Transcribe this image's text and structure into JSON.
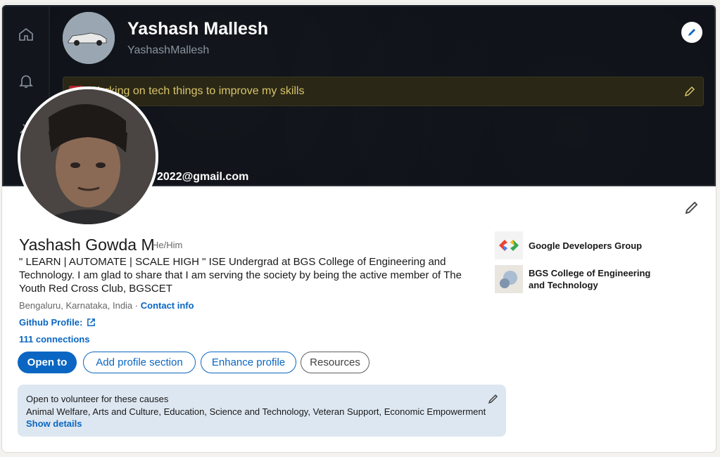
{
  "banner": {
    "github_name": "Yashash Mallesh",
    "github_username": "YashashMallesh",
    "status_text": "Working on tech things to improve my skills",
    "email_partial": "2022@gmail.com",
    "rail_icons": [
      "home-icon",
      "bell-icon",
      "pin-icon",
      "globe-icon"
    ]
  },
  "profile": {
    "name": "Yashash Gowda M",
    "pronouns": "He/Him",
    "headline": "\" LEARN | AUTOMATE | SCALE HIGH \" ISE Undergrad at BGS College of Engineering and Technology. I am glad to share that I am serving the society by being the active member of The Youth Red Cross Club, BGSCET",
    "location": "Bengaluru, Karnataka, India · ",
    "contact_info": "Contact info",
    "github_link": "Github Profile:",
    "connections": "111 connections"
  },
  "buttons": {
    "open_to": "Open to",
    "add_section": "Add profile section",
    "enhance": "Enhance profile",
    "resources": "Resources"
  },
  "volunteer": {
    "title": "Open to volunteer for these causes",
    "causes": "Animal Welfare, Arts and Culture, Education, Science and Technology, Veteran Support, Economic Empowerment",
    "show_details": "Show details"
  },
  "experience": [
    {
      "name": "Google Developers Group"
    },
    {
      "name": "BGS College of Engineering and Technology"
    }
  ],
  "colors": {
    "accent": "#0a66c2",
    "banner_bg": "#0d1117",
    "volunteer_bg": "#dde7f1"
  }
}
